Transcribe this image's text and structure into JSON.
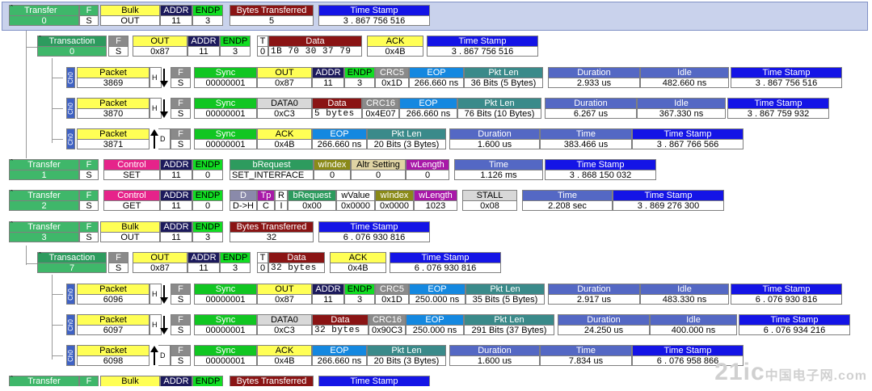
{
  "rows": {
    "t0": {
      "transfer": "Transfer",
      "num": "0",
      "f": "F",
      "fv": "S",
      "type": "Bulk",
      "typev": "OUT",
      "addr": "ADDR",
      "addrv": "11",
      "endp": "ENDP",
      "endpv": "3",
      "bt": "Bytes Transferred",
      "btv": "5",
      "ts": "Time Stamp",
      "tsv": "3 . 867 756 516"
    },
    "x0": {
      "label": "Transaction",
      "num": "0",
      "f": "F",
      "fv": "S",
      "pid": "OUT",
      "pidv": "0x87",
      "addr": "ADDR",
      "addrv": "11",
      "endp": "ENDP",
      "endpv": "3",
      "t": "T",
      "tv": "0",
      "data": "Data",
      "datav": "1B 70 30 37 79",
      "ack": "ACK",
      "ackv": "0x4B",
      "ts": "Time Stamp",
      "tsv": "3 . 867 756 516"
    },
    "p3869": {
      "ch": "Ch0",
      "pkt": "Packet",
      "num": "3869",
      "h": "H",
      "f": "F",
      "fv": "S",
      "sync": "Sync",
      "syncv": "00000001",
      "pid": "OUT",
      "pidv": "0x87",
      "addr": "ADDR",
      "addrv": "11",
      "endp": "ENDP",
      "endpv": "3",
      "crc": "CRC5",
      "crcv": "0x1D",
      "eop": "EOP",
      "eopv": "266.660 ns",
      "len": "Pkt Len",
      "lenv": "36 Bits (5 Bytes)",
      "dur": "Duration",
      "durv": "2.933 us",
      "idle": "Idle",
      "idlev": "482.660 ns",
      "ts": "Time Stamp",
      "tsv": "3 . 867 756 516"
    },
    "p3870": {
      "ch": "Ch0",
      "pkt": "Packet",
      "num": "3870",
      "h": "H",
      "f": "F",
      "fv": "S",
      "sync": "Sync",
      "syncv": "00000001",
      "pid": "DATA0",
      "pidv": "0xC3",
      "data": "Data",
      "datav": "5 bytes",
      "crc": "CRC16",
      "crcv": "0x4E07",
      "eop": "EOP",
      "eopv": "266.660 ns",
      "len": "Pkt Len",
      "lenv": "76 Bits (10 Bytes)",
      "dur": "Duration",
      "durv": "6.267 us",
      "idle": "Idle",
      "idlev": "367.330 ns",
      "ts": "Time Stamp",
      "tsv": "3 . 867 759 932"
    },
    "p3871": {
      "ch": "Ch0",
      "pkt": "Packet",
      "num": "3871",
      "d": "D",
      "f": "F",
      "fv": "S",
      "sync": "Sync",
      "syncv": "00000001",
      "pid": "ACK",
      "pidv": "0x4B",
      "eop": "EOP",
      "eopv": "266.660 ns",
      "len": "Pkt Len",
      "lenv": "20 Bits (3 Bytes)",
      "dur": "Duration",
      "durv": "1.600 us",
      "time": "Time",
      "timev": "383.466 us",
      "ts": "Time Stamp",
      "tsv": "3 . 867 766 566"
    },
    "t1": {
      "transfer": "Transfer",
      "num": "1",
      "f": "F",
      "fv": "S",
      "type": "Control",
      "typev": "SET",
      "addr": "ADDR",
      "addrv": "11",
      "endp": "ENDP",
      "endpv": "0",
      "breq": "bRequest",
      "breqv": "SET_INTERFACE",
      "widx": "wIndex",
      "widxv": "0",
      "alt": "Altr Setting",
      "altv": "0",
      "wlen": "wLength",
      "wlenv": "0",
      "time": "Time",
      "timev": "1.126 ms",
      "ts": "Time Stamp",
      "tsv": "3 . 868 150 032"
    },
    "t2": {
      "transfer": "Transfer",
      "num": "2",
      "f": "F",
      "fv": "S",
      "type": "Control",
      "typev": "GET",
      "addr": "ADDR",
      "addrv": "11",
      "endp": "ENDP",
      "endpv": "0",
      "d": "D",
      "dv": "D->H",
      "tp": "Tp",
      "tpv": "C",
      "r": "R",
      "rv": "I",
      "breq": "bRequest",
      "breqv": "0x00",
      "wval": "wValue",
      "wvalv": "0x0000",
      "widx": "wIndex",
      "widxv": "0x0000",
      "wlen": "wLength",
      "wlenv": "1023",
      "stall": "STALL",
      "stallv": "0x08",
      "time": "Time",
      "timev": "2.208 sec",
      "ts": "Time Stamp",
      "tsv": "3 . 869 276 300"
    },
    "t3": {
      "transfer": "Transfer",
      "num": "3",
      "f": "F",
      "fv": "S",
      "type": "Bulk",
      "typev": "OUT",
      "addr": "ADDR",
      "addrv": "11",
      "endp": "ENDP",
      "endpv": "3",
      "bt": "Bytes Transferred",
      "btv": "32",
      "ts": "Time Stamp",
      "tsv": "6 . 076 930 816"
    },
    "x7": {
      "label": "Transaction",
      "num": "7",
      "f": "F",
      "fv": "S",
      "pid": "OUT",
      "pidv": "0x87",
      "addr": "ADDR",
      "addrv": "11",
      "endp": "ENDP",
      "endpv": "3",
      "t": "T",
      "tv": "0",
      "data": "Data",
      "datav": "32 bytes",
      "ack": "ACK",
      "ackv": "0x4B",
      "ts": "Time Stamp",
      "tsv": "6 . 076 930 816"
    },
    "p6096": {
      "ch": "Ch0",
      "pkt": "Packet",
      "num": "6096",
      "h": "H",
      "f": "F",
      "fv": "S",
      "sync": "Sync",
      "syncv": "00000001",
      "pid": "OUT",
      "pidv": "0x87",
      "addr": "ADDR",
      "addrv": "11",
      "endp": "ENDP",
      "endpv": "3",
      "crc": "CRC5",
      "crcv": "0x1D",
      "eop": "EOP",
      "eopv": "250.000 ns",
      "len": "Pkt Len",
      "lenv": "35 Bits (5 Bytes)",
      "dur": "Duration",
      "durv": "2.917 us",
      "idle": "Idle",
      "idlev": "483.330 ns",
      "ts": "Time Stamp",
      "tsv": "6 . 076 930 816"
    },
    "p6097": {
      "ch": "Ch0",
      "pkt": "Packet",
      "num": "6097",
      "h": "H",
      "f": "F",
      "fv": "S",
      "sync": "Sync",
      "syncv": "00000001",
      "pid": "DATA0",
      "pidv": "0xC3",
      "data": "Data",
      "datav": "32 bytes",
      "crc": "CRC16",
      "crcv": "0x90C3",
      "eop": "EOP",
      "eopv": "250.000 ns",
      "len": "Pkt Len",
      "lenv": "291 Bits (37 Bytes)",
      "dur": "Duration",
      "durv": "24.250 us",
      "idle": "Idle",
      "idlev": "400.000 ns",
      "ts": "Time Stamp",
      "tsv": "6 . 076 934 216"
    },
    "p6098": {
      "ch": "Ch0",
      "pkt": "Packet",
      "num": "6098",
      "d": "D",
      "f": "F",
      "fv": "S",
      "sync": "Sync",
      "syncv": "00000001",
      "pid": "ACK",
      "pidv": "0x4B",
      "eop": "EOP",
      "eopv": "266.660 ns",
      "len": "Pkt Len",
      "lenv": "20 Bits (3 Bytes)",
      "dur": "Duration",
      "durv": "1.600 us",
      "time": "Time",
      "timev": "7.834 us",
      "ts": "Time Stamp",
      "tsv": "6 . 076 958 866"
    },
    "t4": {
      "transfer": "Transfer",
      "f": "F",
      "type": "Bulk",
      "addr": "ADDR",
      "endp": "ENDP",
      "bt": "Bytes Transferred",
      "ts": "Time Stamp"
    }
  },
  "watermark": {
    "main": "21ic",
    "sub": "中国电子网",
    "tld": ".com"
  },
  "icons": {
    "collapse": "minus-tick-icon",
    "host_arrow": "down-arrow-icon",
    "device_arrow": "up-arrow-icon"
  }
}
